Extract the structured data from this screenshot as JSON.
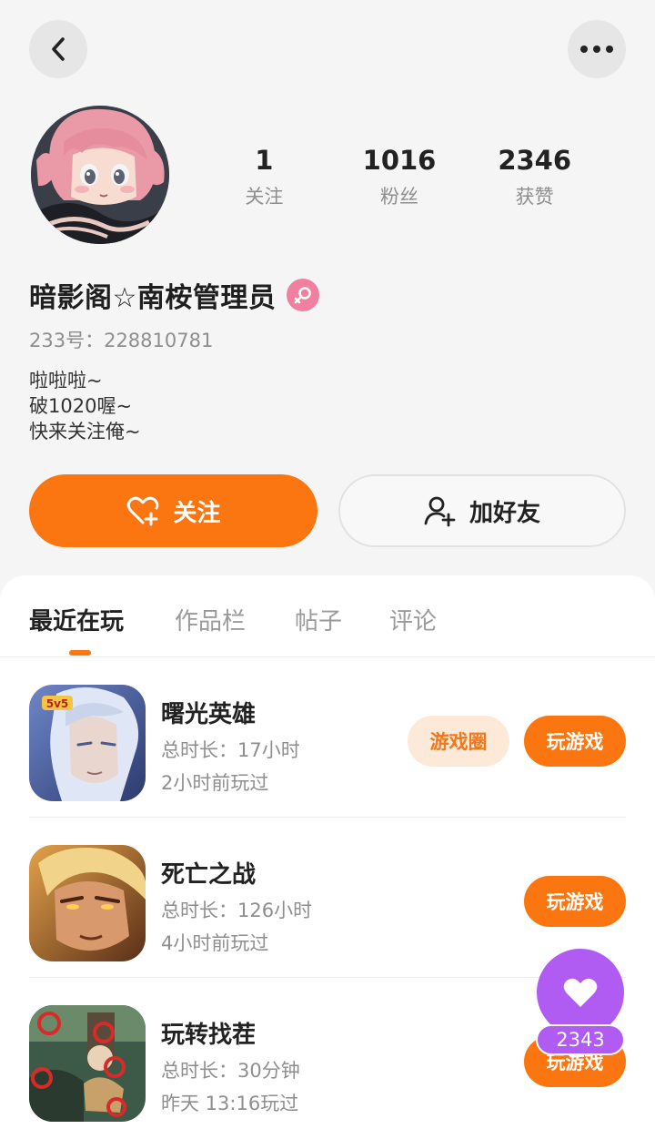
{
  "header": {
    "back_icon": "chevron-left-icon",
    "more_icon": "more-dots-icon"
  },
  "profile": {
    "stats": [
      {
        "value": "1",
        "label": "关注"
      },
      {
        "value": "1016",
        "label": "粉丝"
      },
      {
        "value": "2346",
        "label": "获赞"
      }
    ],
    "username": "暗影阁☆南桉管理员",
    "gender_icon": "female-icon",
    "gender_color": "#f07fa0",
    "uid": "233号：228810781",
    "bio": [
      "啦啦啦~",
      "破1020喔~",
      "快来关注俺~"
    ]
  },
  "actions": {
    "follow_label": "关注",
    "follow_icon": "heart-plus-icon",
    "add_friend_label": "加好友",
    "add_friend_icon": "user-plus-icon"
  },
  "tabs": [
    {
      "label": "最近在玩",
      "active": true
    },
    {
      "label": "作品栏",
      "active": false
    },
    {
      "label": "帖子",
      "active": false
    },
    {
      "label": "评论",
      "active": false
    }
  ],
  "games": [
    {
      "name": "曙光英雄",
      "duration": "总时长：17小时",
      "last_played": "2小时前玩过",
      "circle_label": "游戏圈",
      "play_label": "玩游戏"
    },
    {
      "name": "死亡之战",
      "duration": "总时长：126小时",
      "last_played": "4小时前玩过",
      "play_label": "玩游戏"
    },
    {
      "name": "玩转找茬",
      "duration": "总时长：30分钟",
      "last_played": "昨天 13:16玩过",
      "play_label": "玩游戏"
    }
  ],
  "like_fab": {
    "icon": "heart-icon",
    "count": "2343",
    "color": "#b05cf2"
  },
  "colors": {
    "accent": "#fb7510",
    "accent_light": "#fde9d8"
  }
}
